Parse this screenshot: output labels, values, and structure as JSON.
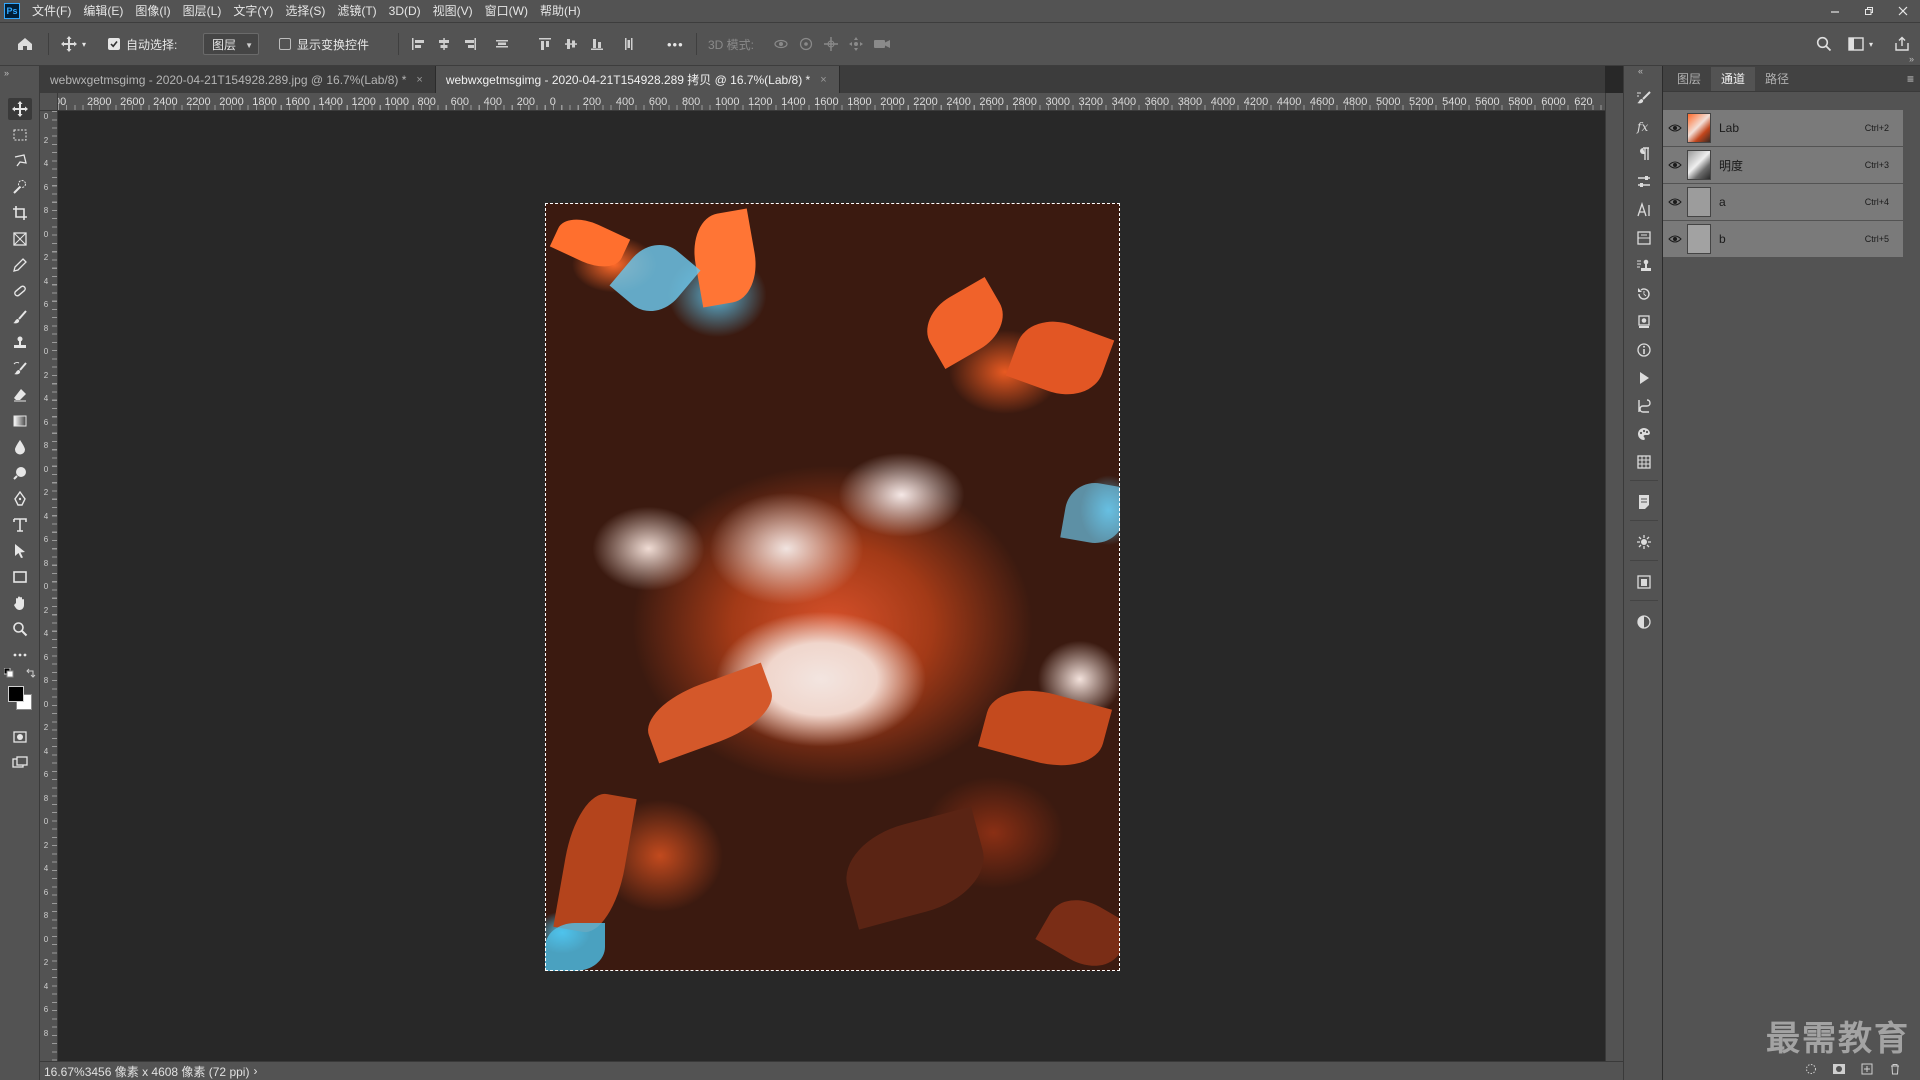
{
  "app": {
    "logo_text": "Ps"
  },
  "menu": [
    "文件(F)",
    "编辑(E)",
    "图像(I)",
    "图层(L)",
    "文字(Y)",
    "选择(S)",
    "滤镜(T)",
    "3D(D)",
    "视图(V)",
    "窗口(W)",
    "帮助(H)"
  ],
  "options": {
    "auto_select_label": "自动选择:",
    "auto_select_checked": true,
    "layer_select_value": "图层",
    "transform_controls_label": "显示变换控件",
    "transform_controls_checked": false,
    "more_label": "•••",
    "mode_3d_label": "3D 模式:"
  },
  "tabs": [
    {
      "label": "webwxgetmsgimg - 2020-04-21T154928.289.jpg @ 16.7%(Lab/8) *",
      "active": false
    },
    {
      "label": "webwxgetmsgimg - 2020-04-21T154928.289 拷贝 @ 16.7%(Lab/8) *",
      "active": true
    }
  ],
  "ruler_h_labels": [
    "00",
    "2800",
    "2600",
    "2400",
    "2200",
    "2000",
    "1800",
    "1600",
    "1400",
    "1200",
    "1000",
    "800",
    "600",
    "400",
    "200",
    "0",
    "200",
    "400",
    "600",
    "800",
    "1000",
    "1200",
    "1400",
    "1600",
    "1800",
    "2000",
    "2200",
    "2400",
    "2600",
    "2800",
    "3000",
    "3200",
    "3400",
    "3600",
    "3800",
    "4000",
    "4200",
    "4400",
    "4600",
    "4800",
    "5000",
    "5200",
    "5400",
    "5600",
    "5800",
    "6000",
    "620"
  ],
  "ruler_v_labels": [
    "0",
    "2",
    "4",
    "6",
    "8",
    "0",
    "2",
    "4",
    "6",
    "8",
    "0",
    "2",
    "4",
    "6",
    "8",
    "0",
    "2",
    "4",
    "6",
    "8",
    "0",
    "2",
    "4",
    "6",
    "8",
    "0",
    "2",
    "4",
    "6",
    "8",
    "0",
    "2",
    "4",
    "6",
    "8",
    "0",
    "2",
    "4",
    "6",
    "8"
  ],
  "status": {
    "text": "16.67%3456 像素 x 4608 像素 (72 ppi)",
    "arrow": "›"
  },
  "panel": {
    "tabs": [
      "图层",
      "通道",
      "路径"
    ],
    "active_tab": 1,
    "menu_icon": "≡",
    "channels": [
      {
        "name": "Lab",
        "shortcut": "Ctrl+2"
      },
      {
        "name": "明度",
        "shortcut": "Ctrl+3"
      },
      {
        "name": "a",
        "shortcut": "Ctrl+4"
      },
      {
        "name": "b",
        "shortcut": "Ctrl+5"
      }
    ]
  },
  "watermark": "最需教育",
  "colors": {
    "chrome": "#535353",
    "canvas_bg": "#282828",
    "channel_selected": "#7a7a7a",
    "accent": "#31a8ff"
  }
}
